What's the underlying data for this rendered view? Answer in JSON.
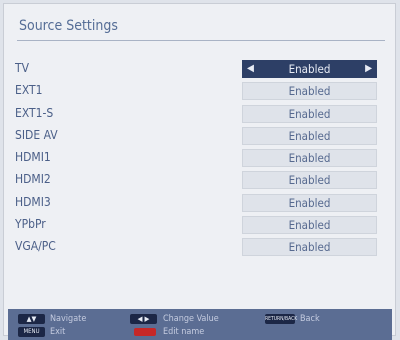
{
  "title": "Source Settings",
  "rows": [
    {
      "label": "TV",
      "value": "Enabled",
      "selected": true
    },
    {
      "label": "EXT1",
      "value": "Enabled"
    },
    {
      "label": "EXT1-S",
      "value": "Enabled"
    },
    {
      "label": "SIDE AV",
      "value": "Enabled"
    },
    {
      "label": "HDMI1",
      "value": "Enabled"
    },
    {
      "label": "HDMI2",
      "value": "Enabled"
    },
    {
      "label": "HDMI3",
      "value": "Enabled"
    },
    {
      "label": "YPbPr",
      "value": "Enabled"
    },
    {
      "label": "VGA/PC",
      "value": "Enabled"
    }
  ],
  "footer": {
    "navigate": "Navigate",
    "change_value": "Change Value",
    "back_key": "RETURN/BACK",
    "back": "Back",
    "menu_key": "MENU",
    "exit": "Exit",
    "edit_name": "Edit name"
  },
  "colors": {
    "selected_bg": "#2d3f66",
    "footer_bg": "#5b6d93",
    "red_key": "#c62828"
  }
}
